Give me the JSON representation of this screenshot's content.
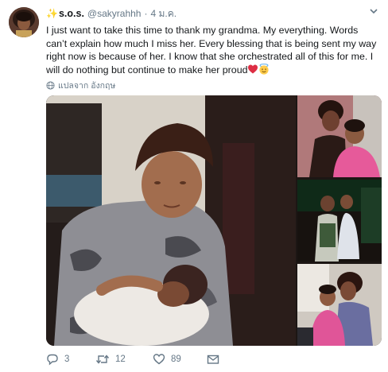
{
  "tweet": {
    "display_name": "s.o.s.",
    "handle": "@sakyrahhh",
    "separator": "·",
    "date": "4 ม.ค.",
    "text": "I just want to take this time to thank my grandma. My everything. Words can’t explain how much I miss her. Every blessing that is being sent my way right now is because of her. I know that she orchestrated all of this for me. I will do nothing but continue to make her proud",
    "translate_label": "แปลจาก อังกฤษ"
  },
  "actions": {
    "reply_count": "3",
    "retweet_count": "12",
    "like_count": "89"
  },
  "icons": {
    "sparkle": "sparkles-icon",
    "menu": "chevron-down-icon",
    "reply": "reply-icon",
    "retweet": "retweet-icon",
    "like": "heart-icon",
    "dm": "envelope-icon"
  },
  "colors": {
    "text": "#14171a",
    "muted": "#657786",
    "sparkle": "#f2b705",
    "heart": "#e0245e",
    "halo_face": "#ffcc4d"
  }
}
